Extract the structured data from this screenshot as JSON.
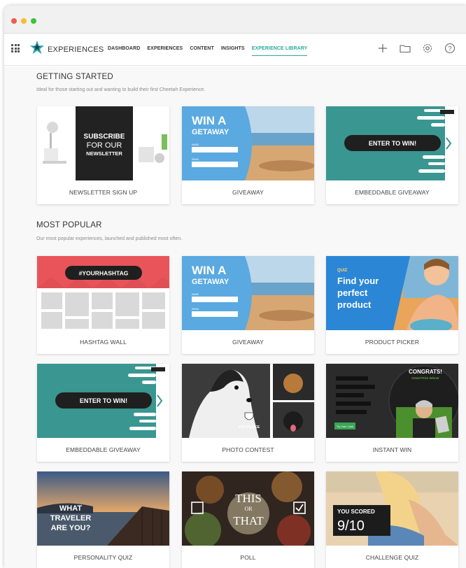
{
  "brand": {
    "name": "EXPERIENCES"
  },
  "nav": {
    "tabs": [
      {
        "label": "DASHBOARD"
      },
      {
        "label": "EXPERIENCES"
      },
      {
        "label": "CONTENT"
      },
      {
        "label": "INSIGHTS"
      },
      {
        "label": "EXPERIENCE LIBRARY",
        "active": true
      }
    ],
    "actions": [
      "plus-icon",
      "folder-icon",
      "gear-icon",
      "help-icon"
    ]
  },
  "sections": {
    "getting_started": {
      "title": "GETTING STARTED",
      "subtitle": "Ideal for those starting out and wanting to build their first Cheetah Experience.",
      "cards": [
        {
          "label": "NEWSLETTER SIGN UP",
          "thumb_text": [
            "SUBSCRIBE",
            "FOR OUR",
            "NEWSLETTER"
          ]
        },
        {
          "label": "GIVEAWAY",
          "thumb_text": [
            "WIN A",
            "GETAWAY",
            "NAME",
            "EMAIL"
          ]
        },
        {
          "label": "EMBEDDABLE GIVEAWAY",
          "thumb_text": [
            "ENTER TO WIN!"
          ]
        }
      ]
    },
    "most_popular": {
      "title": "MOST POPULAR",
      "subtitle": "Our most popular experiences, launched and published most often.",
      "cards": [
        {
          "label": "HASHTAG WALL",
          "thumb_text": [
            "#YOURHASHTAG"
          ]
        },
        {
          "label": "GIVEAWAY",
          "thumb_text": [
            "WIN A",
            "GETAWAY",
            "NAME",
            "EMAIL"
          ]
        },
        {
          "label": "PRODUCT PICKER",
          "thumb_text": [
            "QUIZ",
            "Find your",
            "perfect",
            "product"
          ]
        },
        {
          "label": "EMBEDDABLE GIVEAWAY",
          "thumb_text": [
            "ENTER TO WIN!"
          ]
        },
        {
          "label": "PHOTO CONTEST",
          "thumb_text": [
            "1ST PLACE"
          ]
        },
        {
          "label": "INSTANT WIN",
          "thumb_text": [
            "CONGRATS!",
            "Grand Prize Winner",
            "Try Your Luck"
          ]
        },
        {
          "label": "PERSONALITY QUIZ",
          "thumb_text": [
            "WHAT",
            "TRAVELER",
            "ARE YOU?"
          ]
        },
        {
          "label": "POLL",
          "thumb_text": [
            "THIS",
            "OR",
            "THAT"
          ]
        },
        {
          "label": "CHALLENGE QUIZ",
          "thumb_text": [
            "YOU SCORED",
            "9/10"
          ]
        }
      ]
    }
  },
  "colors": {
    "accent": "#2aa8a0",
    "teal_card": "#3a9690",
    "sky_blue": "#5aa9e0",
    "coral": "#e8545a",
    "quiz_blue": "#2b86d6"
  }
}
